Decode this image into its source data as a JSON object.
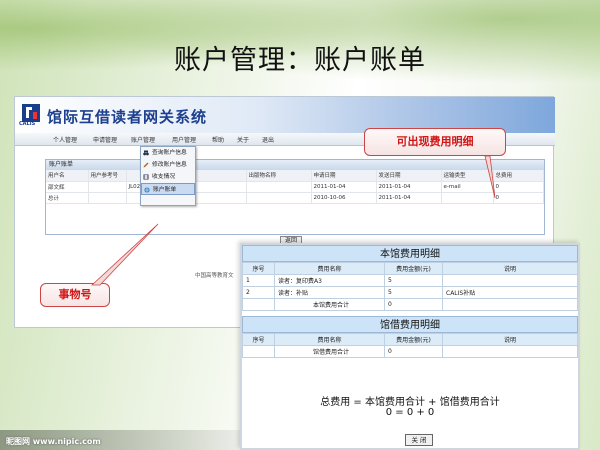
{
  "slide": {
    "title": "账户管理：账户账单"
  },
  "app": {
    "system_title": "馆际互借读者网关系统",
    "logo_text": "CALIS",
    "nav": [
      "个人管理",
      "申请管理",
      "账户管理",
      "用户管理",
      "帮助",
      "关于",
      "退出"
    ],
    "menu": [
      "查询账户信息",
      "修改账户信息",
      "收支情况",
      "账户账单"
    ],
    "panel_title": "账户账单",
    "columns": [
      "用户名",
      "用户参考号",
      "",
      "",
      "出版物名称",
      "申请日期",
      "发送日期",
      "运输类型",
      "总费用"
    ],
    "rows": [
      [
        "邵文辉",
        "",
        "JL0201109304100",
        "",
        "",
        "2011-01-04",
        "2011-01-04",
        "e-mail",
        "0"
      ],
      [
        "总计",
        "",
        "",
        "",
        "",
        "2010-10-06",
        "2011-01-04",
        "",
        "0"
      ]
    ],
    "back_label": "返回",
    "footer": "中国高等教育文"
  },
  "callouts": {
    "detail": "可出现费用明细",
    "txn": "事物号"
  },
  "detail": {
    "local_title": "本馆费用明细",
    "local_cols": [
      "序号",
      "费用名称",
      "费用金额(元)",
      "说明"
    ],
    "local_rows": [
      [
        "1",
        "读者：复印费A3",
        "5",
        ""
      ],
      [
        "2",
        "读者：补贴",
        "5",
        "CALIS补贴"
      ]
    ],
    "local_total": "本馆费用合计",
    "local_total_val": "0",
    "lib_title": "馆借费用明细",
    "lib_cols": [
      "序号",
      "费用名称",
      "费用金额(元)",
      "说明"
    ],
    "lib_total": "馆借费用合计",
    "lib_total_val": "0",
    "formula": "总费用 = 本馆费用合计 + 馆借费用合计",
    "formula_values": "0 = 0 + 0",
    "close_label": "关 闭"
  },
  "watermark": "昵图网 www.nipic.com",
  "colors": {
    "header_blue": "#1c3f8f",
    "callout_red": "#d01515",
    "detail_head": "#cde3f7"
  }
}
